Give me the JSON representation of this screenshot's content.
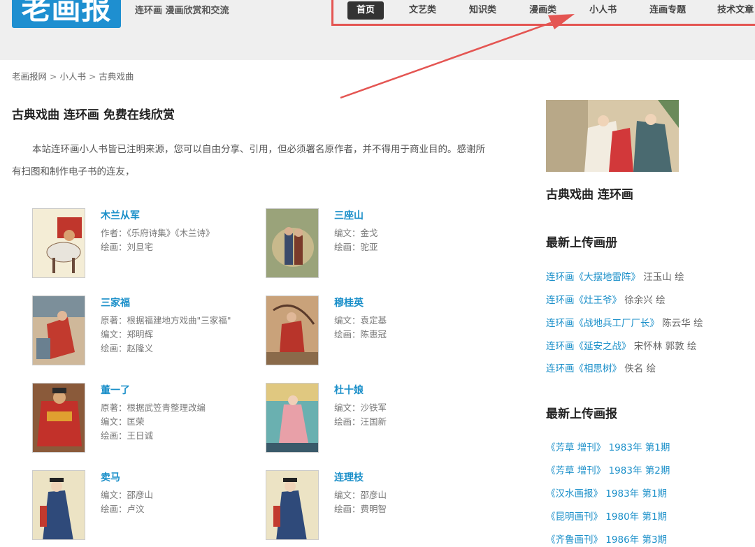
{
  "header": {
    "logo": "老画报",
    "slogan": "连环画 漫画欣赏和交流",
    "nav": [
      "首页",
      "文艺类",
      "知识类",
      "漫画类",
      "小人书",
      "连画专题",
      "技术文章"
    ]
  },
  "breadcrumb": [
    "老画报网",
    "小人书",
    "古典戏曲"
  ],
  "page": {
    "title": "古典戏曲 连环画 免费在线欣赏",
    "intro": "本站连环画小人书皆已注明来源，您可以自由分享、引用，但必须署名原作者，并不得用于商业目的。感谢所有扫图和制作电子书的连友，"
  },
  "books": [
    {
      "title": "木兰从军",
      "lines": [
        "作者：《乐府诗集》《木兰诗》",
        "绘画：刘旦宅"
      ]
    },
    {
      "title": "三座山",
      "lines": [
        "编文：金戈",
        "绘画：驼亚"
      ]
    },
    {
      "title": "三家福",
      "lines": [
        "原著：根据福建地方戏曲\"三家福\"",
        "编文：郑明辉",
        "绘画：赵隆义"
      ]
    },
    {
      "title": "穆桂英",
      "lines": [
        "编文：袁定基",
        "绘画：陈惠冠"
      ]
    },
    {
      "title": "董一了",
      "lines": [
        "原著：根据武笠青整理改编",
        "编文：匡荣",
        "绘画：王日诚"
      ]
    },
    {
      "title": "杜十娘",
      "lines": [
        "编文：沙铁军",
        "绘画：汪国新"
      ]
    },
    {
      "title": "卖马",
      "lines": [
        "编文：邵彦山",
        "绘画：卢汶"
      ]
    },
    {
      "title": "连理枝",
      "lines": [
        "编文：邵彦山",
        "绘画：费明智"
      ]
    }
  ],
  "sidebar": {
    "caption": "古典戏曲 连环画",
    "latest_albums_heading": "最新上传画册",
    "latest_albums": [
      {
        "title": "连环画《大摆地雷阵》",
        "author": "汪玉山 绘"
      },
      {
        "title": "连环画《灶王爷》",
        "author": "徐余兴 绘"
      },
      {
        "title": "连环画《战地兵工厂厂长》",
        "author": "陈云华 绘"
      },
      {
        "title": "连环画《延安之战》",
        "author": "宋怀林 郭敦 绘"
      },
      {
        "title": "连环画《相思树》",
        "author": "佚名 绘"
      }
    ],
    "latest_magazines_heading": "最新上传画报",
    "latest_magazines": [
      {
        "title": "《芳草 增刊》",
        "issue": "1983年 第1期"
      },
      {
        "title": "《芳草 增刊》",
        "issue": "1983年 第2期"
      },
      {
        "title": "《汉水画报》",
        "issue": "1983年 第1期"
      },
      {
        "title": "《昆明画刊》",
        "issue": "1980年 第1期"
      },
      {
        "title": "《齐鲁画刊》",
        "issue": "1986年 第3期"
      }
    ]
  },
  "colors": {
    "accent": "#1a8fc9",
    "annotation_red": "#e45552",
    "nav_active": "#333333"
  }
}
